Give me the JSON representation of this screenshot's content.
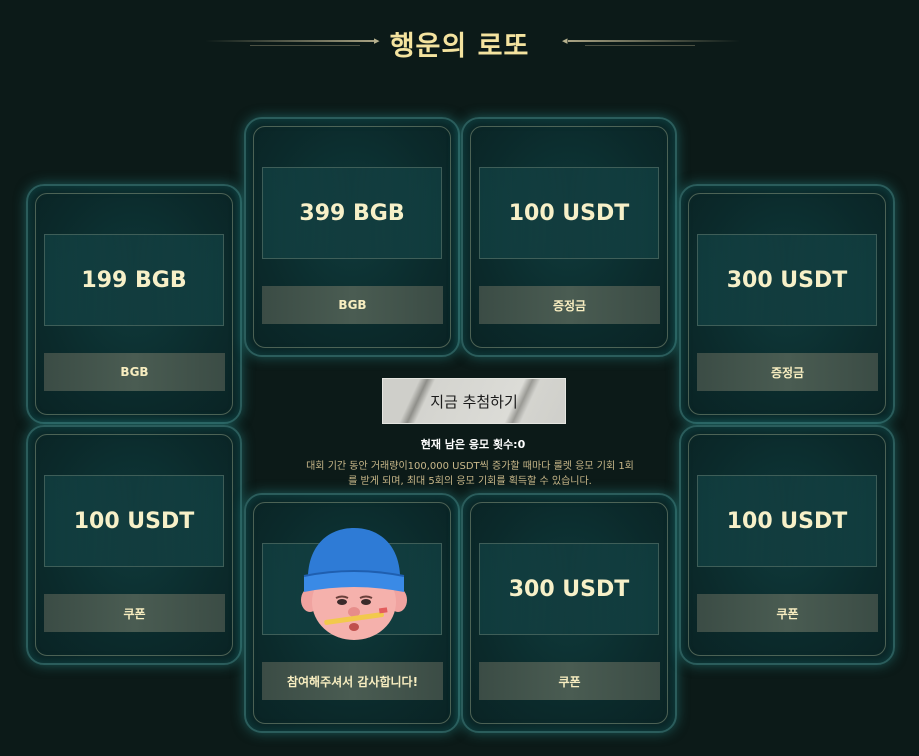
{
  "header": {
    "title": "행운의 로또"
  },
  "cards": [
    {
      "value": "199 BGB",
      "label": "BGB"
    },
    {
      "value": "399 BGB",
      "label": "BGB"
    },
    {
      "value": "100 USDT",
      "label": "증정금"
    },
    {
      "value": "300 USDT",
      "label": "증정금"
    },
    {
      "value": "100 USDT",
      "label": "쿠폰"
    },
    {
      "value": "",
      "label": "참여해주셔서 감사합니다!"
    },
    {
      "value": "300 USDT",
      "label": "쿠폰"
    },
    {
      "value": "100 USDT",
      "label": "쿠폰"
    }
  ],
  "center": {
    "draw_button": "지금 추첨하기",
    "remaining": "현재 남은 응모 횟수:0",
    "description": "대회 기간 동안 거래량이100,000 USDT씩 증가할 때마다 룰렛 응모 기회 1회를 받게 되며, 최대 5회의 응모 기회를 획득할 수 있습니다."
  },
  "colors": {
    "accent": "#f4e39f",
    "background": "#0c1a18",
    "card_border": "#2b5d5c"
  }
}
